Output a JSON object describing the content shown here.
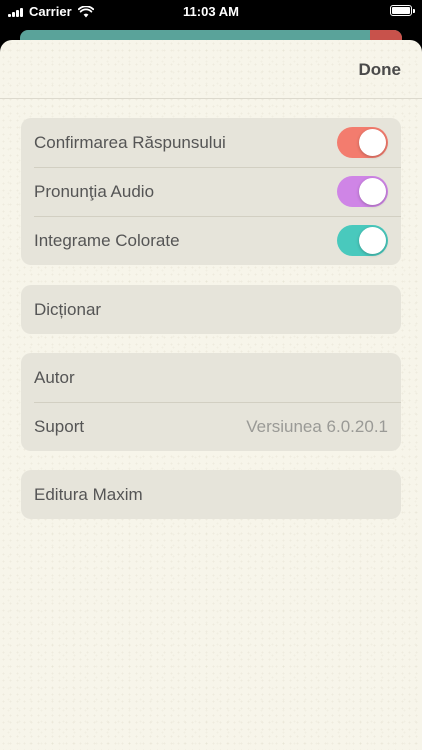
{
  "status_bar": {
    "carrier": "Carrier",
    "time": "11:03 AM",
    "wifi_icon": "wifi-icon",
    "battery_icon": "battery-icon"
  },
  "header": {
    "done_label": "Done"
  },
  "groups": {
    "settings": [
      {
        "label": "Confirmarea Răspunsului",
        "toggle": true,
        "color": "#f37c6e"
      },
      {
        "label": "Pronunţia Audio",
        "toggle": true,
        "color": "#cf85e6"
      },
      {
        "label": "Integrame Colorate",
        "toggle": true,
        "color": "#49c9bd"
      }
    ],
    "dictionary": {
      "label": "Dicționar"
    },
    "about": {
      "author_label": "Autor",
      "support_label": "Suport",
      "version_text": "Versiunea 6.0.20.1"
    },
    "publisher": {
      "label": "Editura Maxim"
    }
  },
  "colors": {
    "sheet_background": "#f7f5ea",
    "group_background": "#e6e4da",
    "behind_card": "#5aa39a",
    "behind_accent": "#c8524b"
  }
}
